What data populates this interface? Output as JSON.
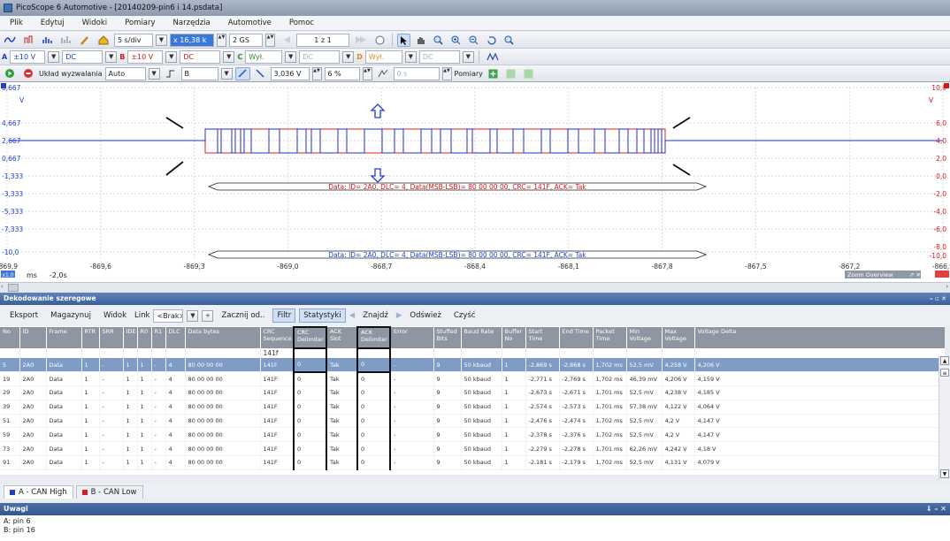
{
  "window": {
    "title": "PicoScope 6 Automotive - [20140209-pin6 i 14.psdata]"
  },
  "menu": [
    "Plik",
    "Edytuj",
    "Widoki",
    "Pomiary",
    "Narzędzia",
    "Automotive",
    "Pomoc"
  ],
  "toolbar1": {
    "timebase": "5 s/div",
    "samples": "x 16,38 k",
    "sample_count": "2 GS",
    "page": "1 z 1"
  },
  "toolbar2": {
    "chA_label": "A",
    "chA_range": "±10 V",
    "chA_coupling": "DC",
    "chB_label": "B",
    "chB_range": "±10 V",
    "chB_coupling": "DC",
    "chC_label": "C",
    "chC_range": "Wył.",
    "chC_coupling": "DC",
    "chD_label": "D",
    "chD_range": "Wył.",
    "chD_coupling": "DC"
  },
  "toolbar3": {
    "trigger_label": "Układ wyzwalania",
    "trigger_mode": "Auto",
    "trigger_source": "B",
    "trigger_level": "3,036 V",
    "trigger_pct": "6 %",
    "pretrigger": "0 s",
    "measurements": "Pomiary"
  },
  "scope": {
    "left_axis": [
      "6,667",
      "4,667",
      "2,667",
      "0,667",
      "-1,333",
      "-3,333",
      "-5,333",
      "-7,333",
      "-10,0"
    ],
    "left_unit": "V",
    "right_axis": [
      "10,0",
      "6,0",
      "4,0",
      "2,0",
      "0,0",
      "-2,0",
      "-4,0",
      "-6,0",
      "-8,0",
      "-10,0"
    ],
    "right_unit": "V",
    "x_axis": [
      "-869,9",
      "-869,6",
      "-869,3",
      "-869,0",
      "-868,7",
      "-868,4",
      "-868,1",
      "-867,8",
      "-867,5",
      "-867,2",
      "-866,9"
    ],
    "x_unit": "ms",
    "x_scale_badge": "x1.0",
    "x_offset": "-2,0s",
    "zoom_overview": "Zoom Overview",
    "decode_label_B": "Data: ID= 2A0, DLC= 4, Data(MSB-LSB)= 80 00 00 00, CRC= 141F, ACK= Tak",
    "decode_label_A": "Data: ID= 2A0, DLC= 4, Data(MSB-LSB)= 80 00 00 00, CRC= 141F, ACK= Tak",
    "colors": {
      "chA": "#1f2fd0",
      "chB": "#e01c1c",
      "grid": "#c9cdd3"
    }
  },
  "decoder": {
    "panel_title": "Dekodowanie szeregowe",
    "buttons": {
      "export": "Eksport",
      "store": "Magazynuj",
      "view": "Widok",
      "link": "Link",
      "nolink": "<Brak>",
      "start_from": "Zacznij od..",
      "filter": "Filtr",
      "stats": "Statystyki",
      "find": "Znajdź",
      "refresh": "Odśwież",
      "clear": "Czyść"
    },
    "filter_value": "141f",
    "columns": [
      "No",
      "ID",
      "Frame",
      "RTR",
      "SRR",
      "IDE",
      "R0",
      "R1",
      "DLC",
      "Data bytes",
      "CRC Sequence",
      "CRC Delimiter",
      "ACK Slot",
      "ACK Delimiter",
      "Error",
      "Stuffed Bits",
      "Baud Rate",
      "Buffer No",
      "Start Time",
      "End Time",
      "Packet Time",
      "Min Voltage",
      "Max Voltage",
      "Voltage Delta"
    ],
    "rows": [
      [
        "5",
        "2A0",
        "Data",
        "1",
        "-",
        "1",
        "1",
        "-",
        "4",
        "80 00 00 00",
        "141F",
        "0",
        "Tak",
        "0",
        "-",
        "9",
        "50 kbaud",
        "1",
        "-2,869 s",
        "-2,868 s",
        "1,702 ms",
        "52,5 mV",
        "4,258 V",
        "4,206 V"
      ],
      [
        "19",
        "2A0",
        "Data",
        "1",
        "-",
        "1",
        "1",
        "-",
        "4",
        "80 00 00 00",
        "141F",
        "0",
        "Tak",
        "0",
        "-",
        "9",
        "50 kbaud",
        "1",
        "-2,771 s",
        "-2,769 s",
        "1,702 ms",
        "46,39 mV",
        "4,206 V",
        "4,159 V"
      ],
      [
        "29",
        "2A0",
        "Data",
        "1",
        "-",
        "1",
        "1",
        "-",
        "4",
        "80 00 00 00",
        "141F",
        "0",
        "Tak",
        "0",
        "-",
        "9",
        "50 kbaud",
        "1",
        "-2,673 s",
        "-2,671 s",
        "1,701 ms",
        "52,5 mV",
        "4,238 V",
        "4,185 V"
      ],
      [
        "39",
        "2A0",
        "Data",
        "1",
        "-",
        "1",
        "1",
        "-",
        "4",
        "80 00 00 00",
        "141F",
        "0",
        "Tak",
        "0",
        "-",
        "9",
        "50 kbaud",
        "1",
        "-2,574 s",
        "-2,573 s",
        "1,701 ms",
        "57,38 mV",
        "4,122 V",
        "4,064 V"
      ],
      [
        "51",
        "2A0",
        "Data",
        "1",
        "-",
        "1",
        "1",
        "-",
        "4",
        "80 00 00 00",
        "141F",
        "0",
        "Tak",
        "0",
        "-",
        "9",
        "50 kbaud",
        "1",
        "-2,476 s",
        "-2,474 s",
        "1,702 ms",
        "52,5 mV",
        "4,2 V",
        "4,147 V"
      ],
      [
        "59",
        "2A0",
        "Data",
        "1",
        "-",
        "1",
        "1",
        "-",
        "4",
        "80 00 00 00",
        "141F",
        "0",
        "Tak",
        "0",
        "-",
        "9",
        "50 kbaud",
        "1",
        "-2,378 s",
        "-2,376 s",
        "1,702 ms",
        "52,5 mV",
        "4,2 V",
        "4,147 V"
      ],
      [
        "73",
        "2A0",
        "Data",
        "1",
        "-",
        "1",
        "1",
        "-",
        "4",
        "80 00 00 00",
        "141F",
        "0",
        "Tak",
        "0",
        "-",
        "9",
        "50 kbaud",
        "1",
        "-2,279 s",
        "-2,278 s",
        "1,701 ms",
        "62,26 mV",
        "4,242 V",
        "4,18 V"
      ],
      [
        "91",
        "2A0",
        "Data",
        "1",
        "-",
        "1",
        "1",
        "-",
        "4",
        "80 00 00 00",
        "141F",
        "0",
        "Tak",
        "0",
        "-",
        "9",
        "50 kbaud",
        "1",
        "-2,181 s",
        "-2,179 s",
        "1,702 ms",
        "52,5 mV",
        "4,131 V",
        "4,079 V"
      ]
    ],
    "channel_tabs": [
      {
        "label": "A - CAN High",
        "color": "#1f3fcf"
      },
      {
        "label": "B - CAN Low",
        "color": "#d81e1e"
      }
    ]
  },
  "notes": {
    "title": "Uwagi",
    "lines": [
      "A: pin 6",
      "B: pin 16"
    ]
  }
}
